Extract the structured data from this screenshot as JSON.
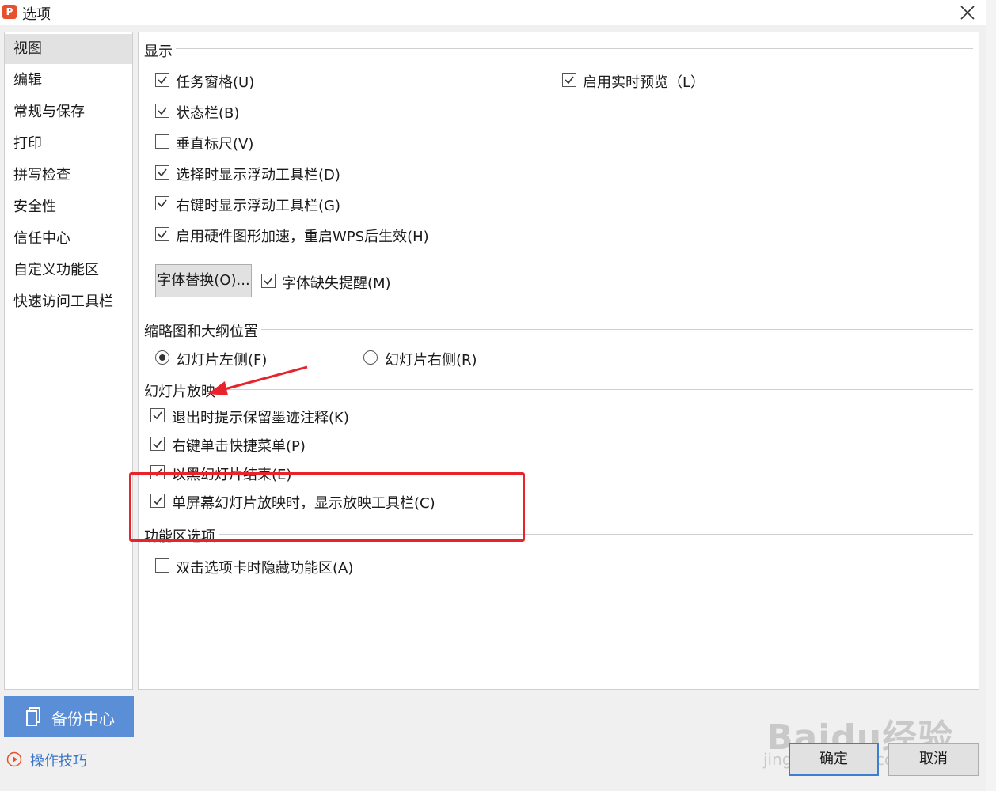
{
  "window": {
    "title": "选项",
    "app_icon": "wps-presentation-icon",
    "close_icon": "close-icon"
  },
  "sidebar": {
    "items": [
      {
        "label": "视图",
        "active": true
      },
      {
        "label": "编辑",
        "active": false
      },
      {
        "label": "常规与保存",
        "active": false
      },
      {
        "label": "打印",
        "active": false
      },
      {
        "label": "拼写检查",
        "active": false
      },
      {
        "label": "安全性",
        "active": false
      },
      {
        "label": "信任中心",
        "active": false
      },
      {
        "label": "自定义功能区",
        "active": false
      },
      {
        "label": "快速访问工具栏",
        "active": false
      }
    ]
  },
  "sections": {
    "display": {
      "title": "显示",
      "options": [
        {
          "label": "任务窗格(U)",
          "checked": true
        },
        {
          "label": "状态栏(B)",
          "checked": true
        },
        {
          "label": "垂直标尺(V)",
          "checked": false
        },
        {
          "label": "选择时显示浮动工具栏(D)",
          "checked": true
        },
        {
          "label": "右键时显示浮动工具栏(G)",
          "checked": true
        },
        {
          "label": "启用硬件图形加速，重启WPS后生效(H)",
          "checked": true
        }
      ],
      "live_preview": {
        "label": "启用实时预览（L）",
        "checked": true
      },
      "font_replace_button": "字体替换(O)...",
      "font_missing": {
        "label": "字体缺失提醒(M)",
        "checked": true
      }
    },
    "thumbnail": {
      "title": "缩略图和大纲位置",
      "left": {
        "label": "幻灯片左侧(F)",
        "selected": true
      },
      "right": {
        "label": "幻灯片右侧(R)",
        "selected": false
      }
    },
    "slideshow": {
      "title": "幻灯片放映",
      "options": [
        {
          "label": "退出时提示保留墨迹注释(K)",
          "checked": true
        },
        {
          "label": "右键单击快捷菜单(P)",
          "checked": true
        },
        {
          "label": "以黑幻灯片结束(E)",
          "checked": true
        },
        {
          "label": "单屏幕幻灯片放映时，显示放映工具栏(C)",
          "checked": true
        }
      ]
    },
    "ribbon": {
      "title": "功能区选项",
      "options": [
        {
          "label": "双击选项卡时隐藏功能区(A)",
          "checked": false
        }
      ]
    }
  },
  "footer": {
    "backup_center": "备份中心",
    "tips": "操作技巧",
    "ok": "确定",
    "cancel": "取消"
  },
  "watermark": {
    "brand": "Baidu经验",
    "url": "jingyan.baidu.com"
  },
  "colors": {
    "accent": "#5a8fd8",
    "link": "#3b74c9",
    "annotation": "#e8232b",
    "app_icon": "#e8502c"
  }
}
